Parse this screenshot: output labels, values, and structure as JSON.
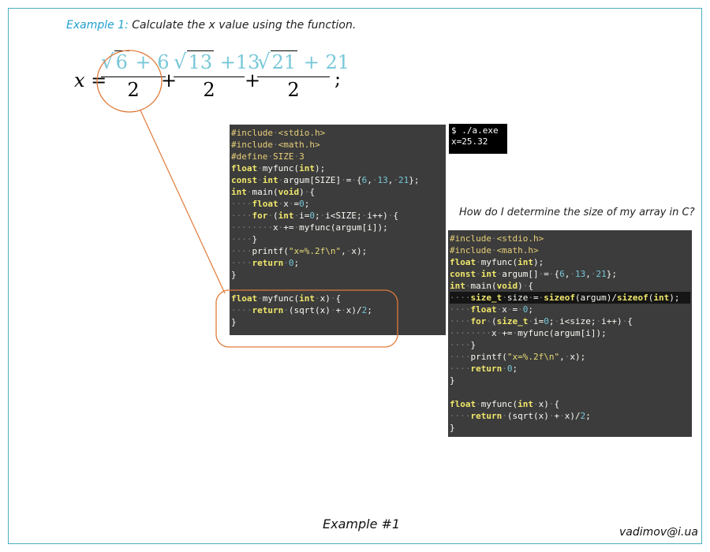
{
  "heading": {
    "label": "Example 1:",
    "text": "Calculate the x value using the function."
  },
  "formula": {
    "lhs": "x =",
    "terms": [
      {
        "radicand": "6",
        "add": "+ 6",
        "denominator": "2"
      },
      {
        "radicand": "13",
        "add": "+13",
        "denominator": "2"
      },
      {
        "radicand": "21",
        "add": "+ 21",
        "denominator": "2"
      }
    ],
    "plus": "+",
    "end": ";"
  },
  "code1": {
    "lines": [
      "#include <stdio.h>",
      "#include <math.h>",
      "#define SIZE 3",
      "float myfunc(int);",
      "const int argum[SIZE] = {6, 13, 21};",
      "int main(void) {",
      "    float x =0;",
      "    for (int i=0; i<SIZE; i++) {",
      "        x += myfunc(argum[i]);",
      "    }",
      "    printf(\"x=%.2f\\n\", x);",
      "    return 0;",
      "}",
      "",
      "float myfunc(int x) {",
      "    return (sqrt(x) + x)/2;",
      "}"
    ]
  },
  "terminal": {
    "lines": [
      "$ ./a.exe",
      "x=25.32"
    ]
  },
  "question": "How do I determine the size of my array in C?",
  "code2": {
    "highlight_line": 4,
    "lines": [
      "#include <stdio.h>",
      "#include <math.h>",
      "float myfunc(int);",
      "const int argum[] = {6, 13, 21};",
      "int main(void) {",
      "    size_t size = sizeof(argum)/sizeof(int);",
      "    float x = 0;",
      "    for (size_t i=0; i<size; i++) {",
      "        x += myfunc(argum[i]);",
      "    }",
      "    printf(\"x=%.2f\\n\", x);",
      "    return 0;",
      "}",
      "",
      "float myfunc(int x) {",
      "    return (sqrt(x) + x)/2;",
      "}"
    ]
  },
  "caption": "Example #1",
  "email": "vadimov@i.ua",
  "colors": {
    "frame": "#4ab0c4",
    "label": "#1f9fd0",
    "annotation": "#e07a3a",
    "code_bg": "#3c3c3c"
  }
}
